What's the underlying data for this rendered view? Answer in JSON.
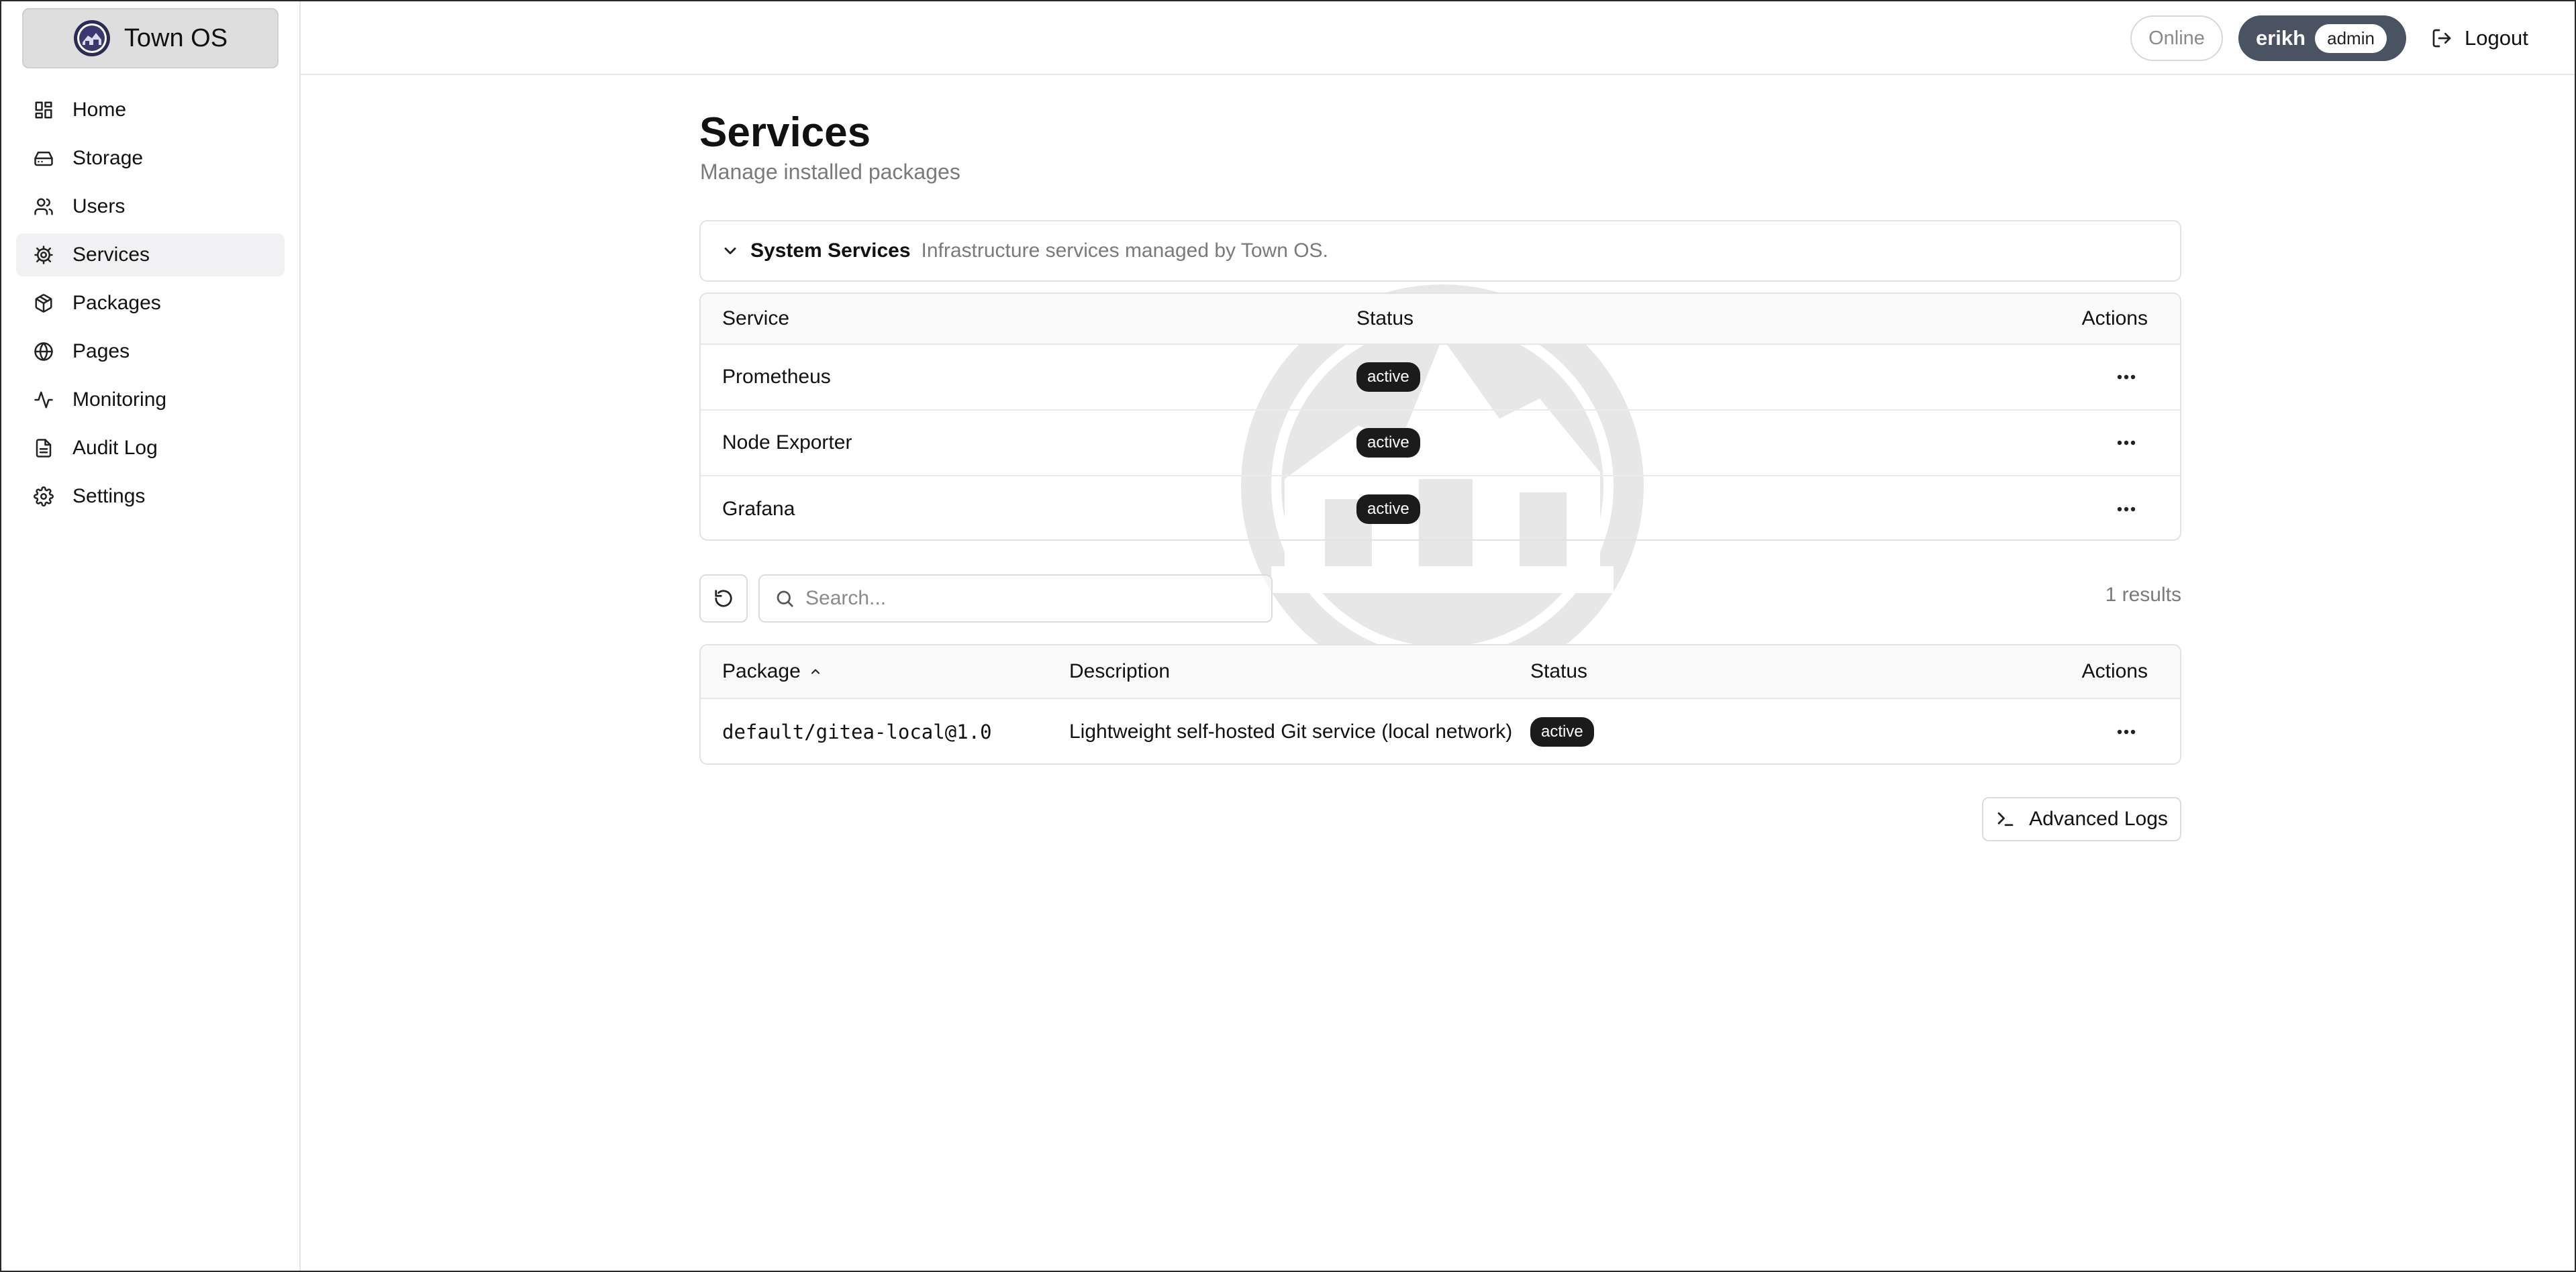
{
  "app": {
    "name": "Town OS"
  },
  "sidebar": {
    "items": [
      {
        "label": "Home",
        "icon": "dashboard-icon"
      },
      {
        "label": "Storage",
        "icon": "hard-drive-icon"
      },
      {
        "label": "Users",
        "icon": "users-icon"
      },
      {
        "label": "Services",
        "icon": "gear-icon",
        "active": true
      },
      {
        "label": "Packages",
        "icon": "package-icon"
      },
      {
        "label": "Pages",
        "icon": "globe-icon"
      },
      {
        "label": "Monitoring",
        "icon": "activity-icon"
      },
      {
        "label": "Audit Log",
        "icon": "document-icon"
      },
      {
        "label": "Settings",
        "icon": "settings-icon"
      }
    ]
  },
  "header": {
    "status": "Online",
    "user": "erikh",
    "role": "admin",
    "logout_label": "Logout"
  },
  "page": {
    "title": "Services",
    "subtitle": "Manage installed packages"
  },
  "system_services": {
    "title": "System Services",
    "description": "Infrastructure services managed by Town OS.",
    "columns": {
      "service": "Service",
      "status": "Status",
      "actions": "Actions"
    },
    "rows": [
      {
        "name": "Prometheus",
        "status": "active"
      },
      {
        "name": "Node Exporter",
        "status": "active"
      },
      {
        "name": "Grafana",
        "status": "active"
      }
    ]
  },
  "toolbar": {
    "search_placeholder": "Search...",
    "results": "1 results"
  },
  "packages": {
    "columns": {
      "package": "Package",
      "description": "Description",
      "status": "Status",
      "actions": "Actions"
    },
    "rows": [
      {
        "package": "default/gitea-local@1.0",
        "description": "Lightweight self-hosted Git service (local network)",
        "status": "active"
      }
    ]
  },
  "advanced_logs_label": "Advanced Logs",
  "colors": {
    "user_pill": "#4a5362",
    "badge": "#1b1b1b",
    "active_nav": "#f1f1f3"
  }
}
